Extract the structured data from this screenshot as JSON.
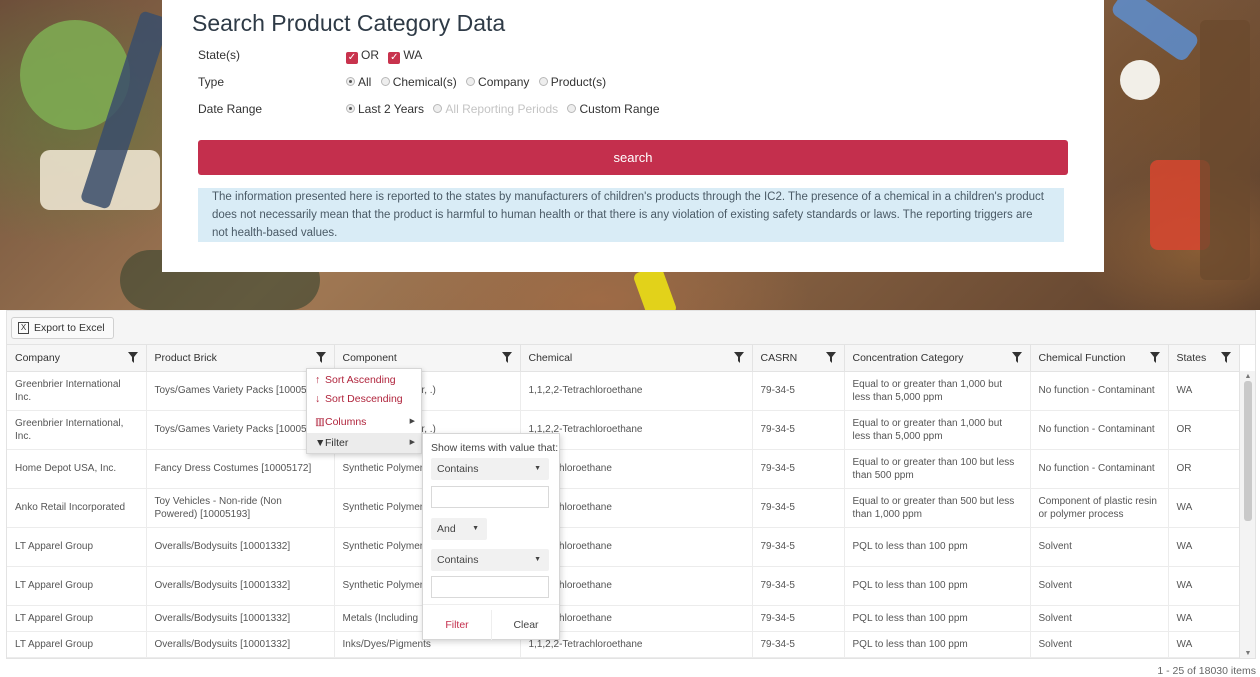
{
  "search": {
    "title": "Search Product Category Data",
    "states": {
      "label": "State(s)",
      "options": [
        "OR",
        "WA"
      ]
    },
    "type": {
      "label": "Type",
      "options": [
        "All",
        "Chemical(s)",
        "Company",
        "Product(s)"
      ],
      "selected": "All"
    },
    "date_range": {
      "label": "Date Range",
      "options": [
        "Last 2 Years",
        "All Reporting Periods",
        "Custom Range"
      ],
      "selected": "Last 2 Years"
    },
    "button_label": "search",
    "disclaimer": "The information presented here is reported to the states by manufacturers of children's products through the IC2. The presence of a chemical in a children's product does not necessarily mean that the product is harmful to human health or that there is any violation of existing safety standards or laws. The reporting triggers are not health-based values."
  },
  "grid": {
    "export_label": "Export to Excel",
    "columns": [
      "Company",
      "Product Brick",
      "Component",
      "Chemical",
      "CASRN",
      "Concentration Category",
      "Chemical Function",
      "States"
    ],
    "rows": [
      [
        "Greenbrier International Inc.",
        "Toys/Games Variety Packs [100051",
        "s (synthetic rubber, .)",
        "1,1,2,2-Tetrachloroethane",
        "79-34-5",
        "Equal to or greater than 1,000 but less than 5,000 ppm",
        "No function - Contaminant",
        "WA"
      ],
      [
        "Greenbrier International, Inc.",
        "Toys/Games Variety Packs [100051",
        "s (synthetic rubber, .)",
        "1,1,2,2-Tetrachloroethane",
        "79-34-5",
        "Equal to or greater than 1,000 but less than 5,000 ppm",
        "No function - Contaminant",
        "OR"
      ],
      [
        "Home Depot USA, Inc.",
        "Fancy Dress Costumes [10005172]",
        "Synthetic Polymer plastics, foams etc",
        "-Tetrachloroethane",
        "79-34-5",
        "Equal to or greater than 100 but less than 500 ppm",
        "No function - Contaminant",
        "OR"
      ],
      [
        "Anko Retail Incorporated",
        "Toy Vehicles - Non-ride (Non Powered) [10005193]",
        "Synthetic Polymer plastics, foams etc",
        "-Tetrachloroethane",
        "79-34-5",
        "Equal to or greater than 500 but less than 1,000 ppm",
        "Component of plastic resin or polymer process",
        "WA"
      ],
      [
        "LT Apparel Group",
        "Overalls/Bodysuits [10001332]",
        "Synthetic Polymer plastics, foams etc",
        "-Tetrachloroethane",
        "79-34-5",
        "PQL to less than 100 ppm",
        "Solvent",
        "WA"
      ],
      [
        "LT Apparel Group",
        "Overalls/Bodysuits [10001332]",
        "Synthetic Polymer plastics, foams etc",
        "-Tetrachloroethane",
        "79-34-5",
        "PQL to less than 100 ppm",
        "Solvent",
        "WA"
      ],
      [
        "LT Apparel Group",
        "Overalls/Bodysuits [10001332]",
        "Metals (Including",
        "-Tetrachloroethane",
        "79-34-5",
        "PQL to less than 100 ppm",
        "Solvent",
        "WA"
      ],
      [
        "LT Apparel Group",
        "Overalls/Bodysuits [10001332]",
        "Inks/Dyes/Pigments",
        "1,1,2,2-Tetrachloroethane",
        "79-34-5",
        "PQL to less than 100 ppm",
        "Solvent",
        "WA"
      ]
    ],
    "pager_info": "1 - 25 of 18030 items"
  },
  "column_menu": {
    "sort_ascending": "Sort Ascending",
    "sort_descending": "Sort Descending",
    "columns": "Columns",
    "filter": "Filter"
  },
  "filter_popup": {
    "hint": "Show items with value that:",
    "operator1": "Contains",
    "logic": "And",
    "operator2": "Contains",
    "filter_label": "Filter",
    "clear_label": "Clear"
  },
  "colors": {
    "accent": "#c42f4d",
    "disclaimer_bg": "#d9ecf6"
  },
  "icons": {
    "checkbox": "checkbox-checked-icon",
    "filter": "filter-funnel-icon",
    "excel": "excel-icon"
  }
}
